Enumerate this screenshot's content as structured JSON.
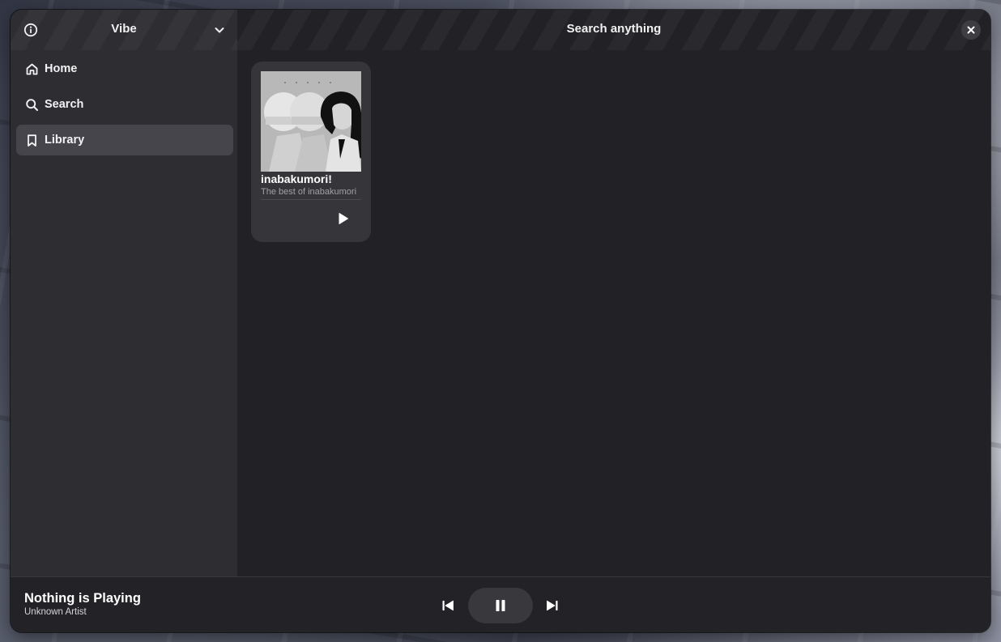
{
  "app": {
    "title": "Vibe"
  },
  "sidebar": {
    "items": [
      {
        "label": "Home",
        "icon": "home-icon",
        "active": false
      },
      {
        "label": "Search",
        "icon": "search-icon",
        "active": false
      },
      {
        "label": "Library",
        "icon": "bookmark-icon",
        "active": true
      }
    ]
  },
  "header": {
    "search_title": "Search anything"
  },
  "library": {
    "cards": [
      {
        "title": "inabakumori!",
        "subtitle": "The best of inabakumori"
      }
    ]
  },
  "player": {
    "now_playing_title": "Nothing is Playing",
    "now_playing_artist": "Unknown Artist",
    "state": "playing"
  },
  "colors": {
    "window_bg": "#222226",
    "sidebar_bg": "#2e2e32",
    "active_item_bg": "#45454b",
    "card_bg": "#36363a"
  }
}
